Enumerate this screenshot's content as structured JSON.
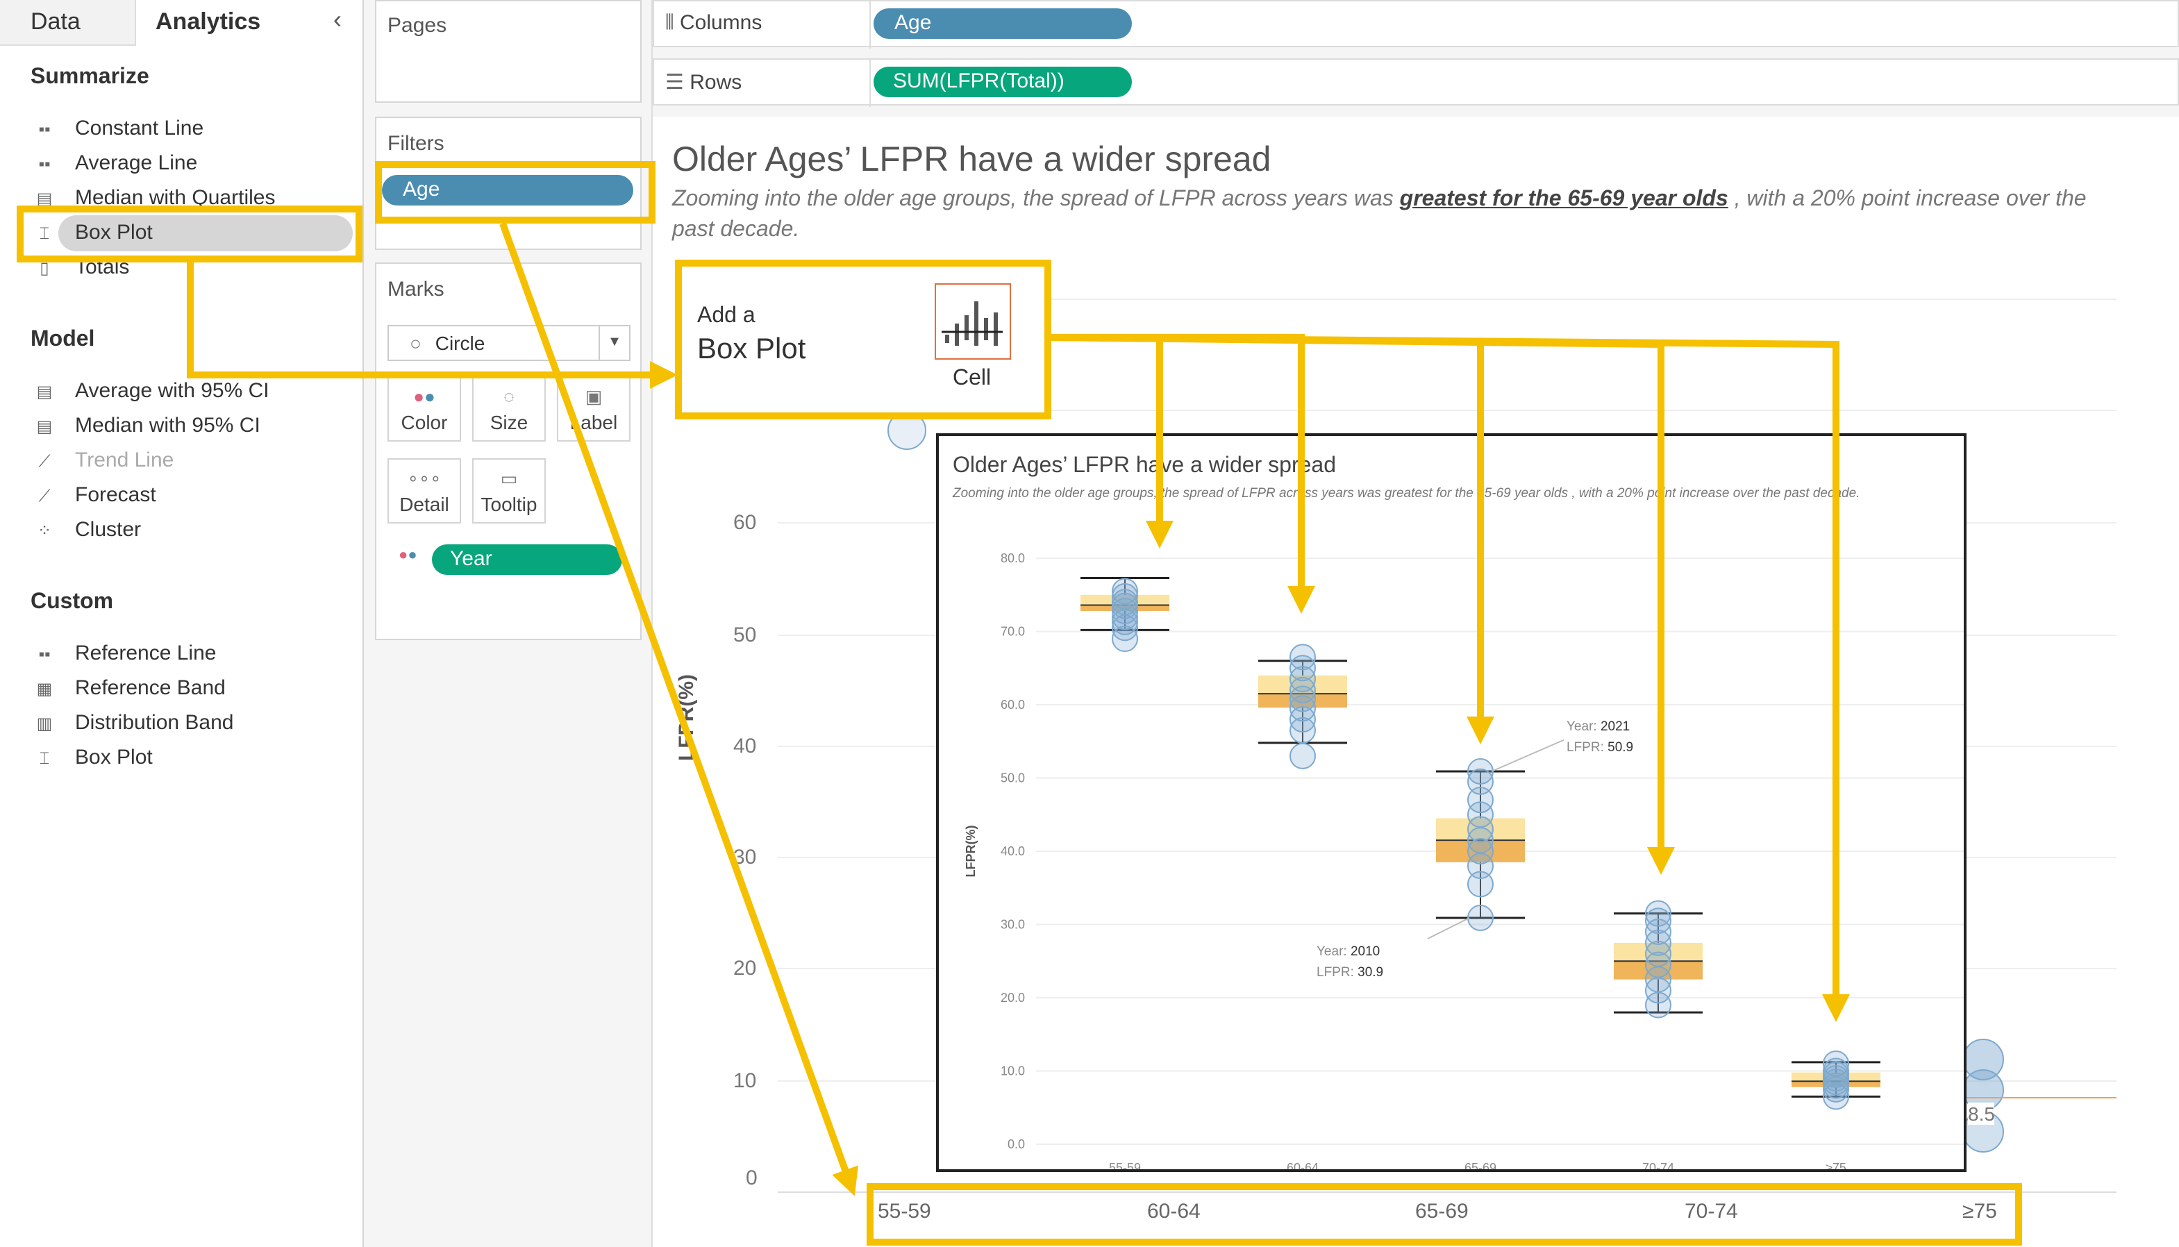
{
  "left_pane": {
    "tabs": {
      "data": "Data",
      "analytics": "Analytics"
    },
    "collapse_icon": "chevron-left-icon",
    "summarize": {
      "heading": "Summarize",
      "items": [
        "Constant Line",
        "Average Line",
        "Median with Quartiles",
        "Box Plot",
        "Totals"
      ]
    },
    "model": {
      "heading": "Model",
      "items": [
        "Average with 95% CI",
        "Median with 95% CI",
        "Trend Line",
        "Forecast",
        "Cluster"
      ]
    },
    "custom": {
      "heading": "Custom",
      "items": [
        "Reference Line",
        "Reference Band",
        "Distribution Band",
        "Box Plot"
      ]
    }
  },
  "middle": {
    "pages_title": "Pages",
    "filters_title": "Filters",
    "filter_pill": "Age",
    "marks_title": "Marks",
    "mark_type": "Circle",
    "buttons": [
      "Color",
      "Size",
      "Label",
      "Detail",
      "Tooltip"
    ],
    "year_pill": "Year"
  },
  "shelves": {
    "columns_label": "Columns",
    "columns_pill": "Age",
    "rows_label": "Rows",
    "rows_pill": "SUM(LFPR(Total))"
  },
  "viz": {
    "title": "Older Ages’ LFPR have a wider spread",
    "subtitle_pre": "Zooming into the older age groups, the spread of LFPR  across years was ",
    "subtitle_link": "greatest for the 65-69 year olds",
    "subtitle_post": " , with a 20% point increase over the",
    "subtitle_line2": "past decade.",
    "y_axis_title": "LFPR(%)",
    "y_ticks": [
      "60",
      "50",
      "40",
      "30",
      "20",
      "10",
      "0"
    ],
    "x_ticks": [
      "55-59",
      "60-64",
      "65-69",
      "70-74",
      "≥75"
    ],
    "partial_value_label": "8.5"
  },
  "popup": {
    "line1": "Add a",
    "line2": "Box Plot",
    "target": "Cell"
  },
  "colors": {
    "highlight": "#f5c000",
    "pill_blue": "#4b8db0",
    "pill_green": "#08a67c",
    "box_orange": "#f0b45a",
    "box_light": "#fbe3a2",
    "mark_blue": "#7da9cf"
  },
  "chart_data": {
    "type": "scatter",
    "title": "Older Ages’ LFPR have a wider spread",
    "subtitle": "Zooming into the older age groups, the spread of LFPR  across years was greatest for the 65-69 year olds , with a 20% point increase over the past decade.",
    "xlabel": "",
    "ylabel": "LFPR(%)",
    "ylim": [
      0,
      80
    ],
    "y_ticks": [
      "80.0",
      "70.0",
      "60.0",
      "50.0",
      "40.0",
      "30.0",
      "20.0",
      "10.0",
      "0.0"
    ],
    "categories": [
      "55-59",
      "60-64",
      "65-69",
      "70-74",
      "≥75"
    ],
    "box_plot": [
      {
        "category": "55-59",
        "values": [
          75.5,
          74.8,
          74.0,
          73.5,
          72.8,
          72.0,
          71.3,
          70.5,
          69.0
        ],
        "whisker_low": 70.2,
        "q1": 72.8,
        "median": 73.6,
        "q3": 75.0,
        "whisker_high": 77.3
      },
      {
        "category": "60-64",
        "values": [
          66.5,
          65.0,
          63.5,
          62.0,
          60.8,
          59.5,
          58.0,
          56.5,
          53.0
        ],
        "whisker_low": 54.8,
        "q1": 59.6,
        "median": 61.5,
        "q3": 64.0,
        "whisker_high": 66.0
      },
      {
        "category": "65-69",
        "values": [
          50.9,
          49.5,
          47.0,
          45.0,
          43.0,
          41.5,
          40.0,
          38.0,
          35.5,
          30.9
        ],
        "whisker_low": 30.9,
        "q1": 38.5,
        "median": 41.5,
        "q3": 44.5,
        "whisker_high": 50.9
      },
      {
        "category": "70-74",
        "values": [
          31.5,
          30.5,
          29.0,
          27.5,
          26.0,
          24.5,
          22.5,
          21.0,
          19.0
        ],
        "whisker_low": 18.0,
        "q1": 22.5,
        "median": 25.0,
        "q3": 27.5,
        "whisker_high": 31.5
      },
      {
        "category": "≥75",
        "values": [
          11.0,
          10.0,
          9.5,
          9.0,
          8.5,
          8.0,
          7.5,
          6.5
        ],
        "whisker_low": 6.5,
        "q1": 7.8,
        "median": 8.6,
        "q3": 9.8,
        "whisker_high": 11.2
      }
    ],
    "tooltips": [
      {
        "year_label": "Year:",
        "year": "2021",
        "lfpr_label": "LFPR:",
        "lfpr": "50.9"
      },
      {
        "year_label": "Year:",
        "year": "2010",
        "lfpr_label": "LFPR:",
        "lfpr": "30.9"
      }
    ],
    "legend": "none",
    "grid": true
  }
}
